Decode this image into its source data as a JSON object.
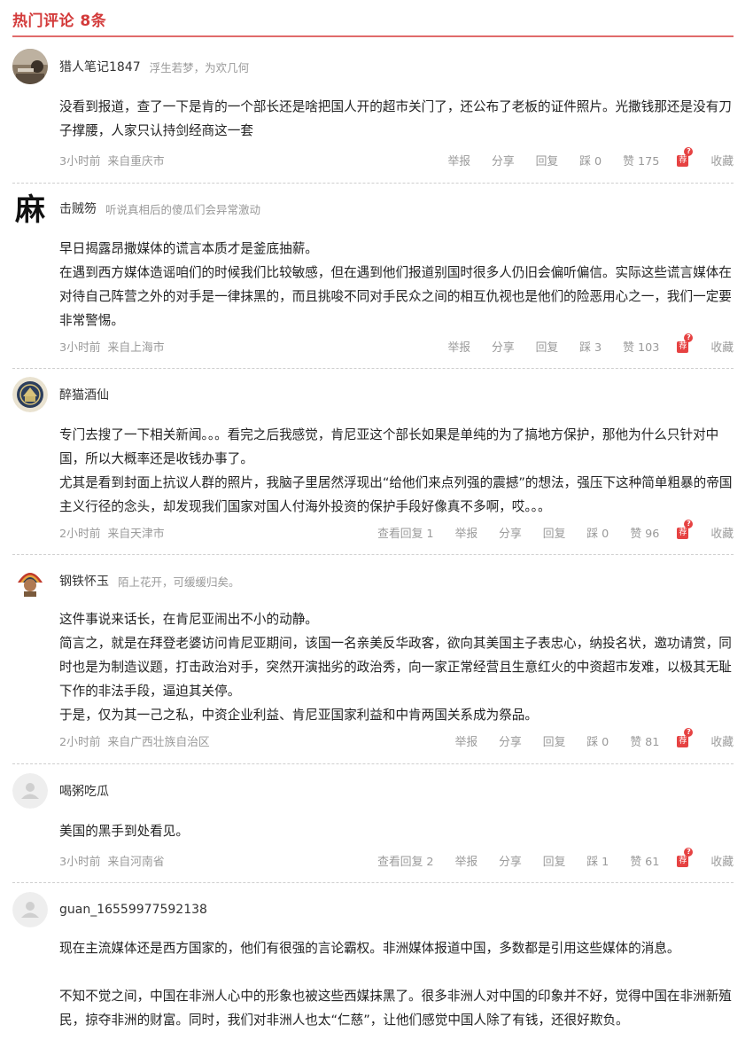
{
  "header": {
    "title": "热门评论 8条"
  },
  "comments": [
    {
      "username": "猎人笔记1847",
      "signature": "浮生若梦，为欢几何",
      "avatar": "photo-avatar",
      "paragraphs": [
        "没看到报道，查了一下是肯的一个部长还是啥把国人开的超市关门了，还公布了老板的证件照片。光撒钱那还是没有刀子撑腰，人家只认持剑经商这一套"
      ],
      "time": "3小时前",
      "location": "来自重庆市",
      "view_replies": "",
      "report": "举报",
      "share": "分享",
      "reply": "回复",
      "dislike_label": "踩",
      "dislikes": "0",
      "like_label": "赞",
      "likes": "175",
      "recommend_badge": "荐",
      "recommend_dot": "?",
      "favorite": "收藏"
    },
    {
      "username": "击贼笏",
      "signature": "听说真相后的傻瓜们会异常激动",
      "avatar": "ma-character-avatar",
      "avatar_char": "麻",
      "paragraphs": [
        "早日揭露昂撒媒体的谎言本质才是釜底抽薪。",
        "在遇到西方媒体造谣咱们的时候我们比较敏感，但在遇到他们报道别国时很多人仍旧会偏听偏信。实际这些谎言媒体在对待自己阵营之外的对手是一律抹黑的，而且挑唆不同对手民众之间的相互仇视也是他们的险恶用心之一，我们一定要非常警惕。"
      ],
      "time": "3小时前",
      "location": "来自上海市",
      "view_replies": "",
      "report": "举报",
      "share": "分享",
      "reply": "回复",
      "dislike_label": "踩",
      "dislikes": "3",
      "like_label": "赞",
      "likes": "103",
      "recommend_badge": "荐",
      "recommend_dot": "?",
      "favorite": "收藏"
    },
    {
      "username": "醉猫酒仙",
      "signature": "",
      "avatar": "emblem-avatar",
      "paragraphs": [
        "专门去搜了一下相关新闻。。。看完之后我感觉，肯尼亚这个部长如果是单纯的为了搞地方保护，那他为什么只针对中国，所以大概率还是收钱办事了。",
        "尤其是看到封面上抗议人群的照片，我脑子里居然浮现出“给他们来点列强的震撼”的想法，强压下这种简单粗暴的帝国主义行径的念头，却发现我们国家对国人付海外投资的保护手段好像真不多啊，哎。。。"
      ],
      "time": "2小时前",
      "location": "来自天津市",
      "view_replies": "查看回复 1",
      "report": "举报",
      "share": "分享",
      "reply": "回复",
      "dislike_label": "踩",
      "dislikes": "0",
      "like_label": "赞",
      "likes": "96",
      "recommend_badge": "荐",
      "recommend_dot": "?",
      "favorite": "收藏"
    },
    {
      "username": "钢铁怀玉",
      "signature": "陌上花开，可缓缓归矣。",
      "avatar": "feather-avatar",
      "paragraphs": [
        "这件事说来话长，在肯尼亚闹出不小的动静。",
        "简言之，就是在拜登老婆访问肯尼亚期间，该国一名亲美反华政客，欲向其美国主子表忠心，纳投名状，邀功请赏，同时也是为制造议题，打击政治对手，突然开演拙劣的政治秀，向一家正常经营且生意红火的中资超市发难，以极其无耻下作的非法手段，逼迫其关停。",
        "于是，仅为其一己之私，中资企业利益、肯尼亚国家利益和中肯两国关系成为祭品。"
      ],
      "time": "2小时前",
      "location": "来自广西壮族自治区",
      "view_replies": "",
      "report": "举报",
      "share": "分享",
      "reply": "回复",
      "dislike_label": "踩",
      "dislikes": "0",
      "like_label": "赞",
      "likes": "81",
      "recommend_badge": "荐",
      "recommend_dot": "?",
      "favorite": "收藏"
    },
    {
      "username": "喝粥吃瓜",
      "signature": "",
      "avatar": "default-avatar",
      "paragraphs": [
        "美国的黑手到处看见。"
      ],
      "time": "3小时前",
      "location": "来自河南省",
      "view_replies": "查看回复 2",
      "report": "举报",
      "share": "分享",
      "reply": "回复",
      "dislike_label": "踩",
      "dislikes": "1",
      "like_label": "赞",
      "likes": "61",
      "recommend_badge": "荐",
      "recommend_dot": "?",
      "favorite": "收藏"
    },
    {
      "username": "guan_16559977592138",
      "signature": "",
      "avatar": "default-avatar",
      "paragraphs": [
        "现在主流媒体还是西方国家的，他们有很强的言论霸权。非洲媒体报道中国，多数都是引用这些媒体的消息。",
        "",
        "不知不觉之间，中国在非洲人心中的形象也被这些西媒抹黑了。很多非洲人对中国的印象并不好，觉得中国在非洲新殖民，掠夺非洲的财富。同时，我们对非洲人也太“仁慈”，让他们感觉中国人除了有钱，还很好欺负。"
      ]
    }
  ]
}
